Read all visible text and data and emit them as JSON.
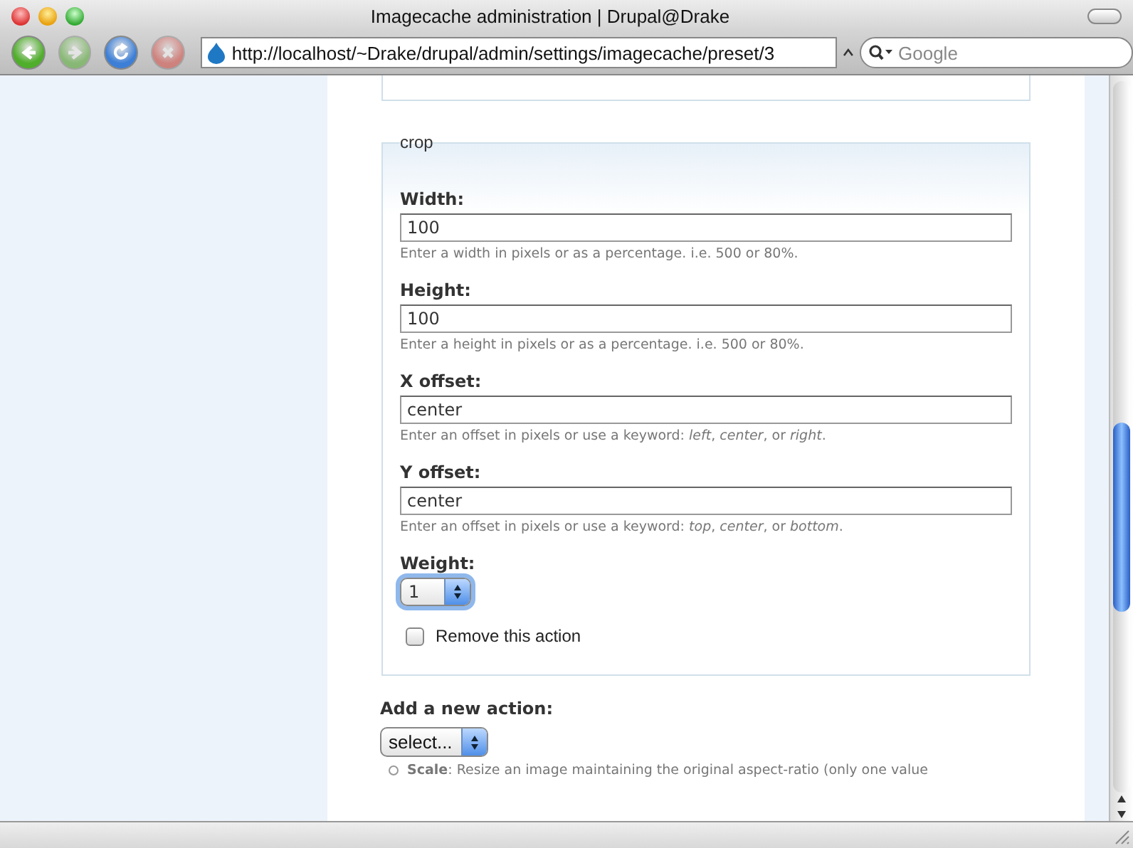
{
  "window": {
    "title": "Imagecache administration | Drupal@Drake"
  },
  "nav_buttons": [
    {
      "kind": "back",
      "disabled": false
    },
    {
      "kind": "forward",
      "disabled": true
    },
    {
      "kind": "reload",
      "disabled": false
    },
    {
      "kind": "stop",
      "disabled": true
    }
  ],
  "address_bar": {
    "value": "http://localhost/~Drake/drupal/admin/settings/imagecache/preset/3"
  },
  "search": {
    "placeholder": "Google"
  },
  "action_fieldset": {
    "legend": "crop",
    "fields": [
      {
        "label": "Width:",
        "value": "100",
        "help": "Enter a width in pixels or as a percentage. i.e. 500 or 80%."
      },
      {
        "label": "Height:",
        "value": "100",
        "help": "Enter a height in pixels or as a percentage. i.e. 500 or 80%."
      },
      {
        "label": "X offset:",
        "value": "center",
        "help": "Enter an offset in pixels or use a keyword: *left*, *center*, or *right*."
      },
      {
        "label": "Y offset:",
        "value": "center",
        "help": "Enter an offset in pixels or use a keyword: *top*, *center*, or *bottom*."
      }
    ],
    "weight": {
      "label": "Weight:",
      "value": "1"
    },
    "remove": {
      "label": "Remove this action",
      "checked": false
    }
  },
  "add_action": {
    "label": "Add a new action:",
    "value": "select...",
    "options": [
      {
        "text": "**Scale**: Resize an image maintaining the original aspect-ratio (only one value",
        "selected": false
      }
    ]
  }
}
